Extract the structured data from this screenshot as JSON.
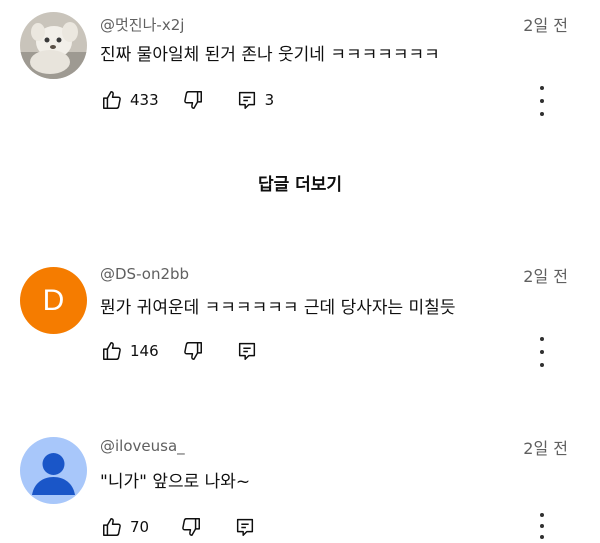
{
  "comments": [
    {
      "author": "@멋진나-x2j",
      "time": "2일 전",
      "text": "진짜 물아일체 된거 존나 웃기네 ㅋㅋㅋㅋㅋㅋㅋ",
      "likes": "433",
      "replies": "3",
      "avatar": "photo"
    },
    {
      "author": "@DS-on2bb",
      "time": "2일 전",
      "text": "뭔가 귀여운데 ㅋㅋㅋㅋㅋㅋ 근데 당사자는 미칠듯",
      "likes": "146",
      "replies": "",
      "avatar": "letter",
      "avatar_letter": "D",
      "avatar_color": "#f57c00"
    },
    {
      "author": "@iloveusa_",
      "time": "2일 전",
      "text": "\"니가\" 앞으로 나와~",
      "likes": "70",
      "replies": "",
      "avatar": "default",
      "avatar_color": "#a8c7fa"
    }
  ],
  "view_more_replies": "답글 더보기",
  "icons": [
    "thumb-up-icon",
    "thumb-down-icon",
    "reply-icon",
    "more-vert-icon"
  ]
}
